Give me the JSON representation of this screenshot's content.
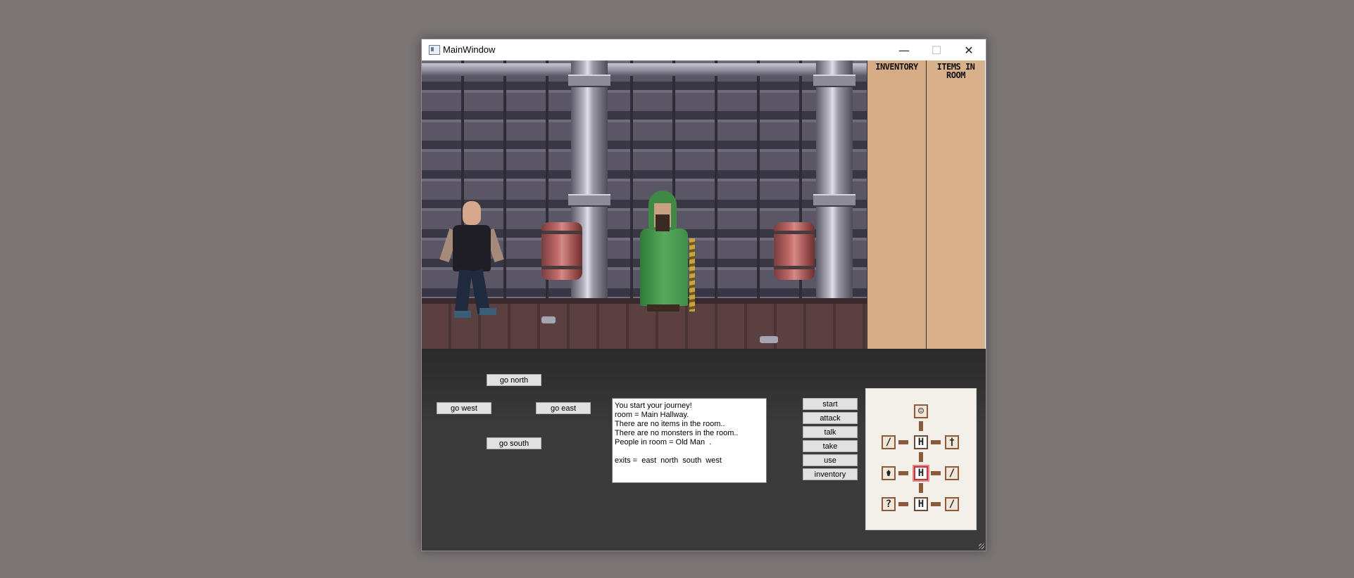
{
  "window": {
    "title": "MainWindow",
    "controls": {
      "minimize": "—",
      "maximize": "☐",
      "close": "✕"
    }
  },
  "panels": {
    "inventory_title": "INVENTORY",
    "items_title_line1": "ITEMS IN",
    "items_title_line2": "ROOM"
  },
  "scene": {
    "player": "player-character",
    "npc": "old-man"
  },
  "navigation": {
    "north": "go north",
    "west": "go west",
    "east": "go east",
    "south": "go south"
  },
  "output_lines": [
    "You start your journey!",
    "room = Main Hallway.",
    "There are no items in the room..",
    "There are no monsters in the room..",
    "People in room = Old Man  .",
    "",
    "exits =  east  north  south  west"
  ],
  "actions": [
    "start",
    "attack",
    "talk",
    "take",
    "use",
    "inventory"
  ],
  "minimap": {
    "cells": [
      {
        "glyph": "",
        "kind": "face-icon"
      },
      {
        "glyph": "",
        "kind": "sword-icon"
      },
      {
        "glyph": "H",
        "kind": "hallway"
      },
      {
        "glyph": "",
        "kind": "dagger-icon"
      },
      {
        "glyph": "",
        "kind": "potion-icon"
      },
      {
        "glyph": "H",
        "kind": "hallway-current"
      },
      {
        "glyph": "",
        "kind": "sword-icon"
      },
      {
        "glyph": "?",
        "kind": "unknown"
      },
      {
        "glyph": "H",
        "kind": "hallway"
      },
      {
        "glyph": "",
        "kind": "sword-icon"
      }
    ],
    "current_color": "#c23838",
    "connector_color": "#8a5a3a"
  }
}
